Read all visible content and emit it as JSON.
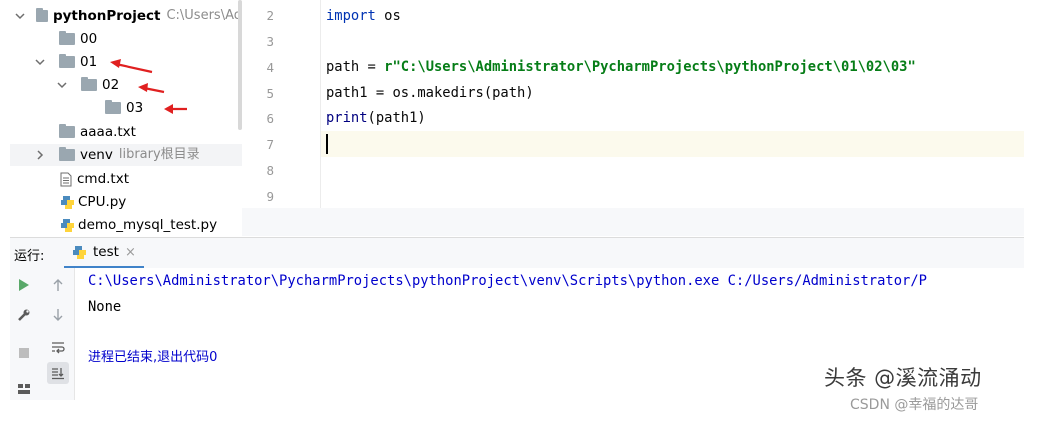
{
  "project_tree": {
    "root": {
      "name": "pythonProject",
      "path": "C:\\Users\\Ad"
    },
    "items": [
      {
        "label": "00",
        "type": "folder"
      },
      {
        "label": "01",
        "type": "folder",
        "expanded": true
      },
      {
        "label": "02",
        "type": "folder",
        "expanded": true
      },
      {
        "label": "03",
        "type": "folder"
      },
      {
        "label": "aaaa.txt",
        "type": "file"
      },
      {
        "label": "venv",
        "type": "folder",
        "note": "library根目录"
      },
      {
        "label": "cmd.txt",
        "type": "file"
      },
      {
        "label": "CPU.py",
        "type": "python"
      },
      {
        "label": "demo_mysql_test.py",
        "type": "python"
      }
    ]
  },
  "editor": {
    "line_numbers": [
      "2",
      "3",
      "4",
      "5",
      "6",
      "7",
      "8",
      "9"
    ],
    "code": {
      "l2_kw": "import",
      "l2_rest": " os",
      "l4_lhs": "path = ",
      "l4_str": "r\"C:\\Users\\Administrator\\PycharmProjects\\pythonProject\\01\\02\\03\"",
      "l5": "path1 = os.makedirs(path)",
      "l6_fn": "print",
      "l6_rest": "(path1)"
    }
  },
  "run_panel": {
    "label": "运行:",
    "tab_label": "test",
    "tab_close": "×",
    "console": {
      "command": "C:\\Users\\Administrator\\PycharmProjects\\pythonProject\\venv\\Scripts\\python.exe C:/Users/Administrator/P",
      "output": "None",
      "exit_message": "进程已结束,退出代码0"
    }
  },
  "colors": {
    "keyword": "#0033b3",
    "string": "#067d17",
    "builtin": "#000080",
    "console_path": "#0000cc",
    "annotation_arrow": "#e02020",
    "run_green": "#59a869"
  },
  "watermarks": {
    "primary": "头条 @溪流涌动",
    "secondary": "CSDN @幸福的达哥"
  }
}
